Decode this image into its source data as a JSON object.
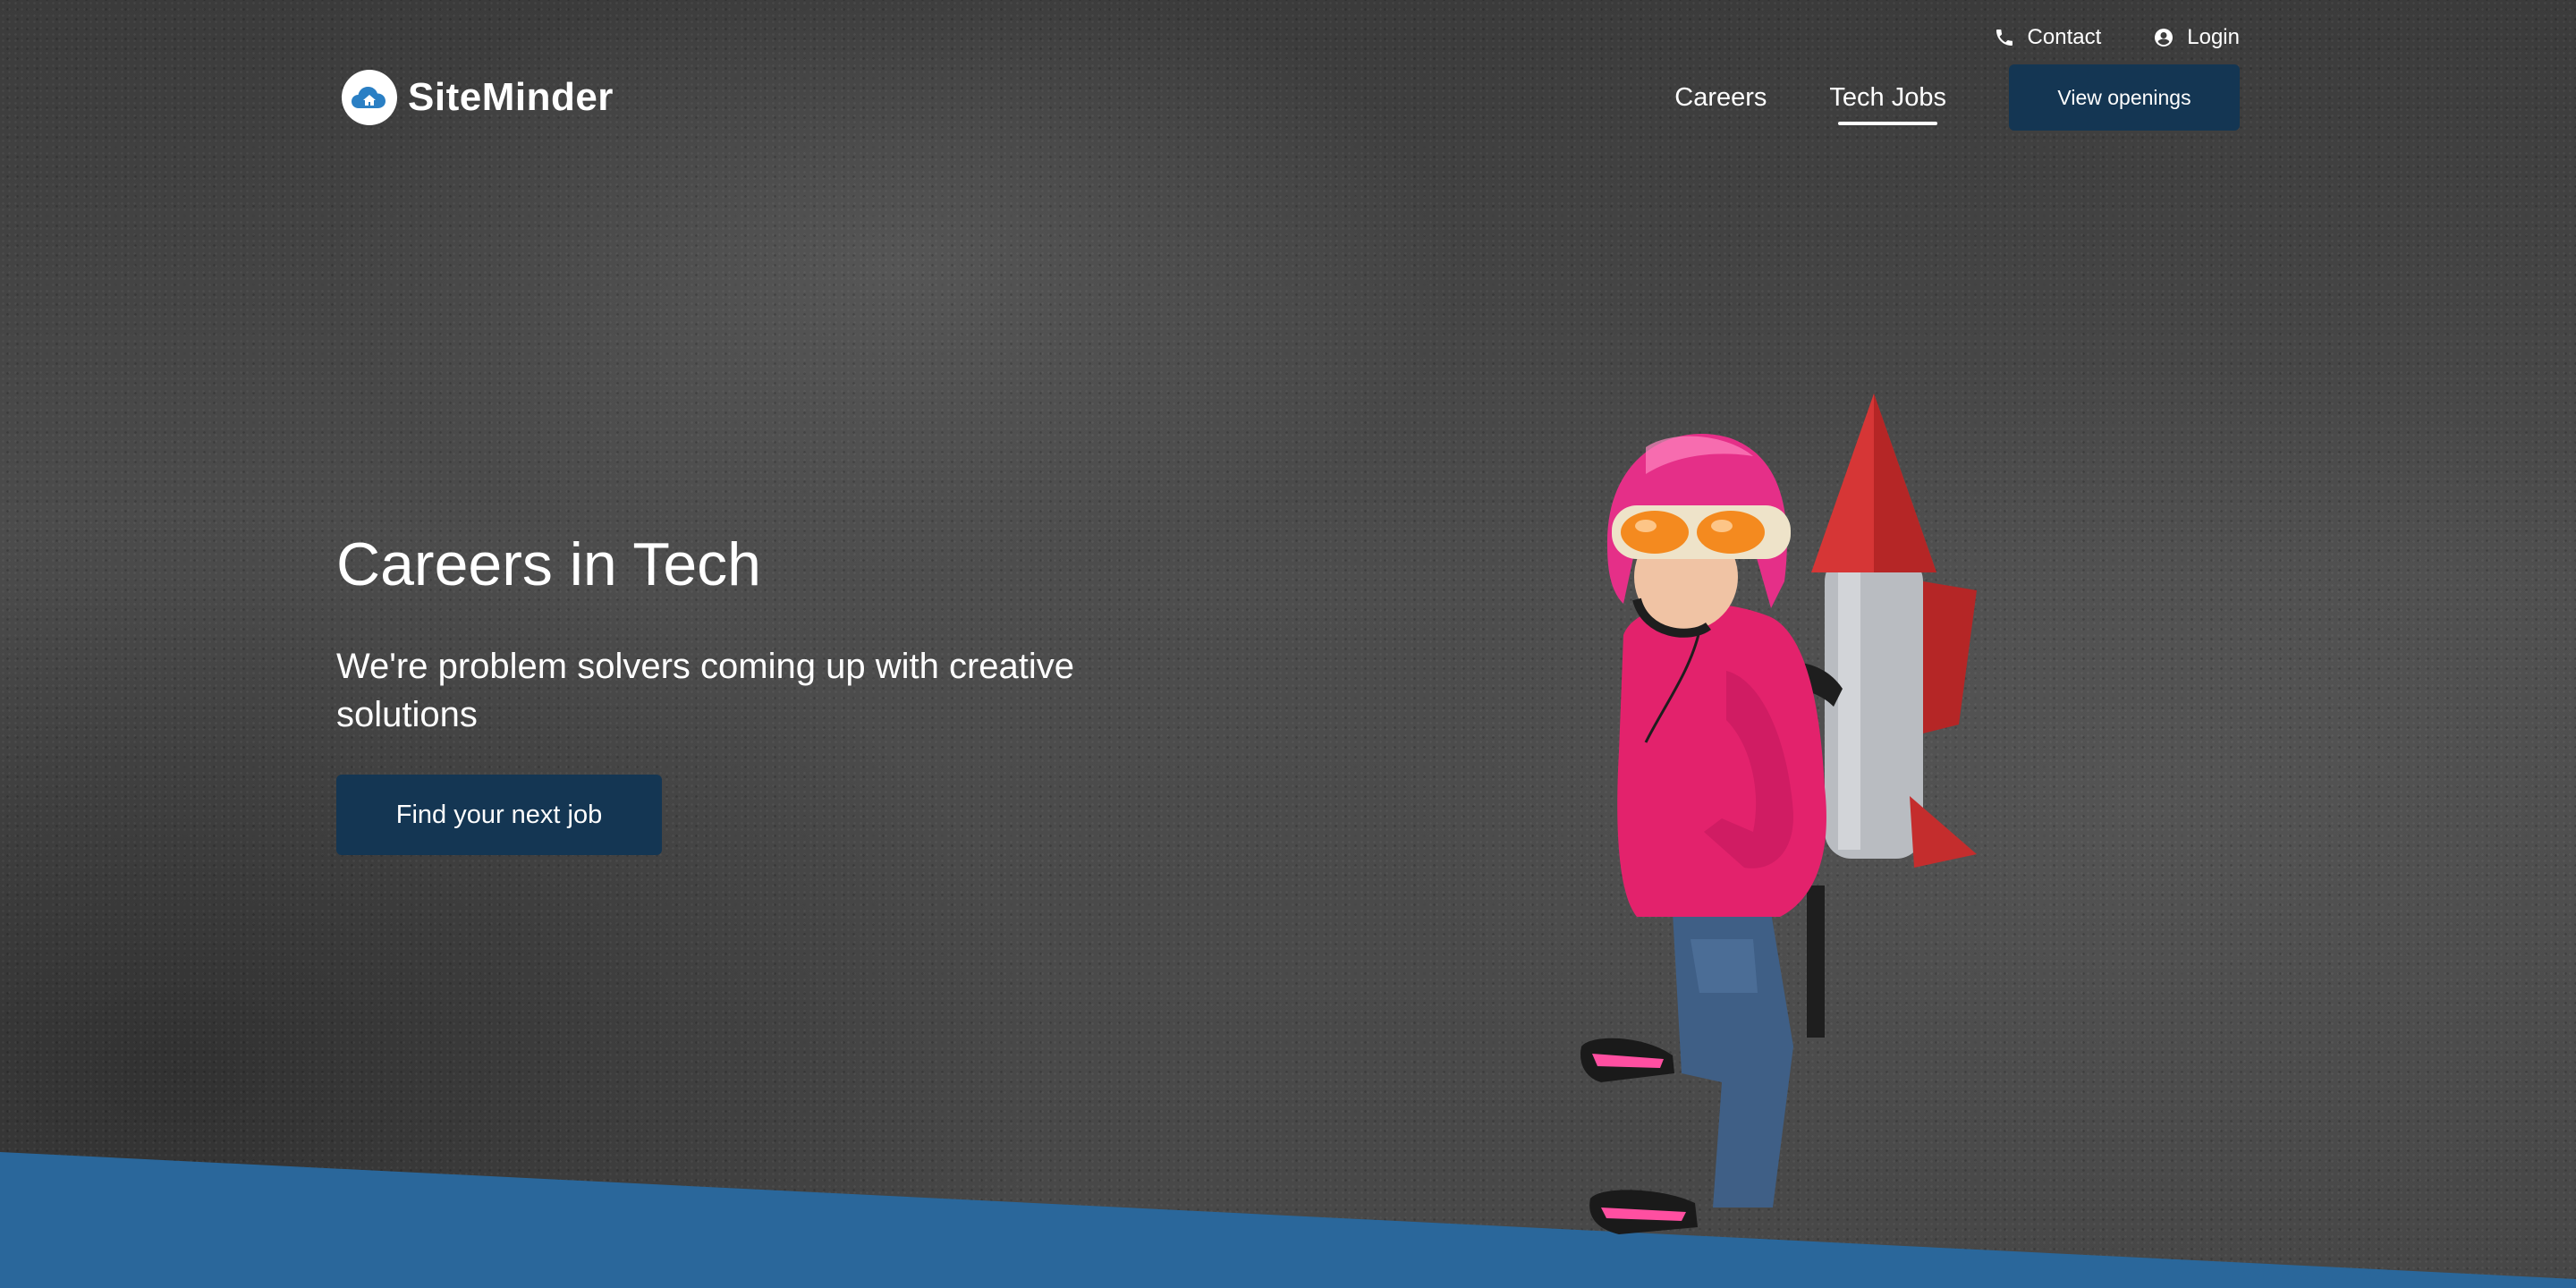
{
  "brand": {
    "name": "SiteMinder"
  },
  "utility": {
    "contact_label": "Contact",
    "login_label": "Login"
  },
  "nav": {
    "items": [
      {
        "label": "Careers"
      },
      {
        "label": "Tech Jobs",
        "active": true
      }
    ],
    "cta_label": "View openings"
  },
  "hero": {
    "title": "Careers in Tech",
    "subtitle": "We're problem solvers coming up with creative solutions",
    "cta_label": "Find your next job"
  },
  "icons": {
    "contact": "phone-icon",
    "login": "user-circle-icon",
    "logo": "cloud-house-icon"
  },
  "colors": {
    "primary_button": "#143653",
    "band": "#2a679b",
    "background": "#4a4a4a"
  }
}
